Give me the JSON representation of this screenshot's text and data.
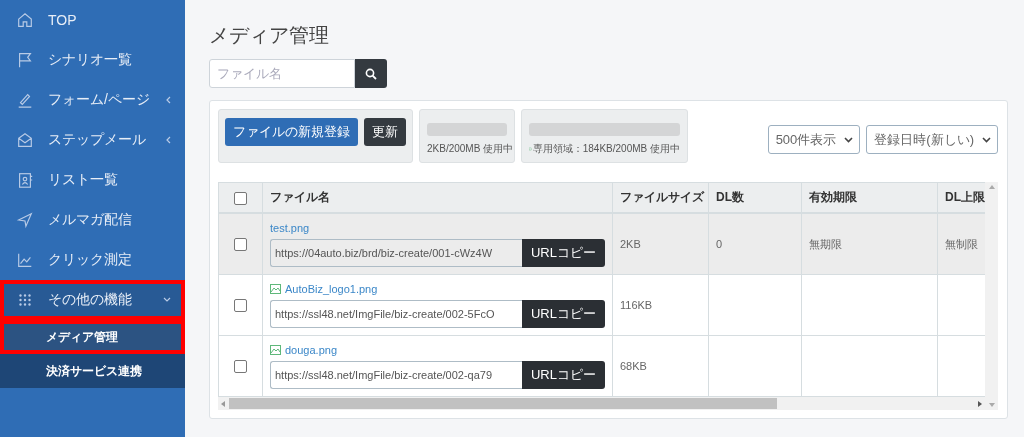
{
  "sidebar": {
    "items": [
      {
        "label": "TOP",
        "expandable": false,
        "expanded": false,
        "highlighted": false
      },
      {
        "label": "シナリオ一覧",
        "expandable": false,
        "expanded": false,
        "highlighted": false
      },
      {
        "label": "フォーム/ページ",
        "expandable": true,
        "expanded": false,
        "highlighted": false
      },
      {
        "label": "ステップメール",
        "expandable": true,
        "expanded": false,
        "highlighted": false
      },
      {
        "label": "リスト一覧",
        "expandable": false,
        "expanded": false,
        "highlighted": false
      },
      {
        "label": "メルマガ配信",
        "expandable": false,
        "expanded": false,
        "highlighted": false
      },
      {
        "label": "クリック測定",
        "expandable": false,
        "expanded": false,
        "highlighted": false
      },
      {
        "label": "その他の機能",
        "expandable": true,
        "expanded": true,
        "highlighted": true,
        "children": [
          {
            "label": "メディア管理",
            "selected": true,
            "highlighted": true
          },
          {
            "label": "決済サービス連携",
            "selected": false,
            "highlighted": false
          }
        ]
      }
    ]
  },
  "page": {
    "title": "メディア管理",
    "search": {
      "placeholder": "ファイル名"
    }
  },
  "toolbar": {
    "buttons": [
      {
        "label": "ファイルの新規登録",
        "kind": "primary"
      },
      {
        "label": "更新",
        "kind": "dark"
      }
    ],
    "storage": [
      {
        "text": "2KB/200MB 使用中",
        "icon": false
      },
      {
        "text": "専用領域：184KB/200MB 使用中",
        "icon": true
      }
    ],
    "selects": [
      {
        "value": "500件表示"
      },
      {
        "value": "登録日時(新しい)"
      }
    ]
  },
  "table": {
    "select_all_checked": false,
    "columns": [
      "ファイル名",
      "ファイルサイズ",
      "DL数",
      "有効期限",
      "DL上限"
    ],
    "rows": [
      {
        "checked": false,
        "hovered": true,
        "name": "test.png",
        "image_icon": false,
        "url": "https://04auto.biz/brd/biz-create/001-cWz4W",
        "copy": "URLコピー",
        "size": "2KB",
        "downloads": "0",
        "expiry": "無期限",
        "limit": "無制限"
      },
      {
        "checked": false,
        "hovered": false,
        "name": "AutoBiz_logo1.png",
        "image_icon": true,
        "url": "https://ssl48.net/ImgFile/biz-create/002-5FcO",
        "copy": "URLコピー",
        "size": "116KB"
      },
      {
        "checked": false,
        "hovered": false,
        "name": "douga.png",
        "image_icon": true,
        "url": "https://ssl48.net/ImgFile/biz-create/002-qa79",
        "copy": "URLコピー",
        "size": "68KB"
      }
    ]
  }
}
